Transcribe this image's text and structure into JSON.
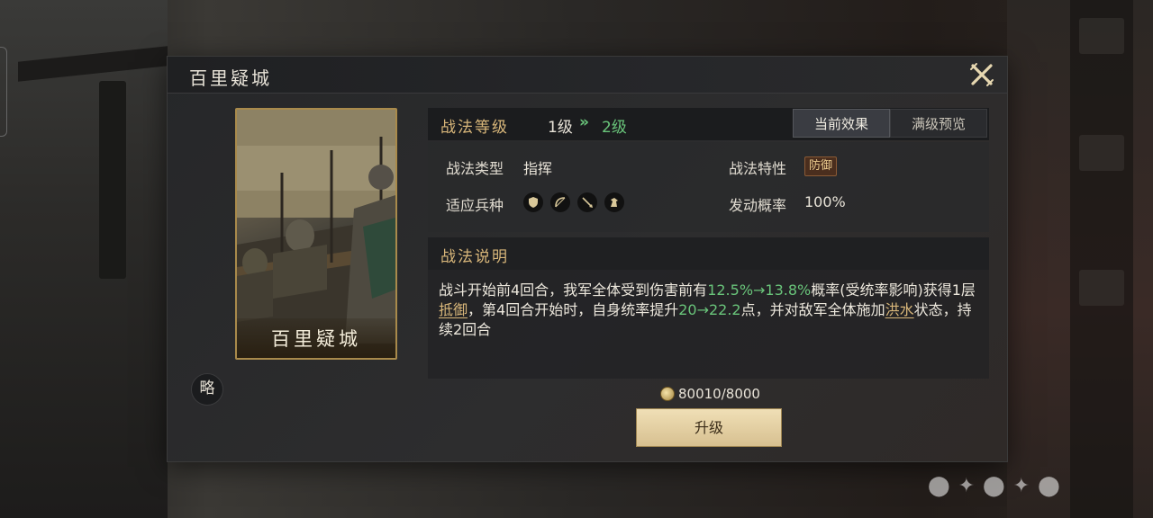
{
  "dialog": {
    "title": "百里疑城",
    "card_name": "百里疑城",
    "side_tag": "略"
  },
  "level": {
    "label": "战法等级",
    "current": "1级",
    "arrow": "»",
    "next": "2级",
    "tabs": [
      "当前效果",
      "满级预览"
    ],
    "active_tab": 0
  },
  "info": {
    "type_label": "战法类型",
    "type_value": "指挥",
    "trait_label": "战法特性",
    "trait_value": "防御",
    "troops_label": "适应兵种",
    "troop_icons": [
      "shield-icon",
      "bow-icon",
      "spear-icon",
      "horse-icon"
    ],
    "rate_label": "发动概率",
    "rate_value": "100%"
  },
  "description": {
    "title": "战法说明",
    "t1": "战斗开始前4回合，我军全体受到伤害前有",
    "g1": "12.5%→13.8%",
    "t2": "概率(受统率影响)获得1层",
    "u1": "抵御",
    "t3": "，第4回合开始时，自身统率提升",
    "g2": "20→22.2",
    "t4": "点，并对敌军全体施加",
    "u2": "洪水",
    "t5": "状态，持续2回合"
  },
  "cost": {
    "value": "80010/8000"
  },
  "upgrade_label": "升级",
  "colors": {
    "accent_gold": "#d9b77a",
    "increase_green": "#69c47a",
    "button_bg": "#e6d2a4"
  }
}
